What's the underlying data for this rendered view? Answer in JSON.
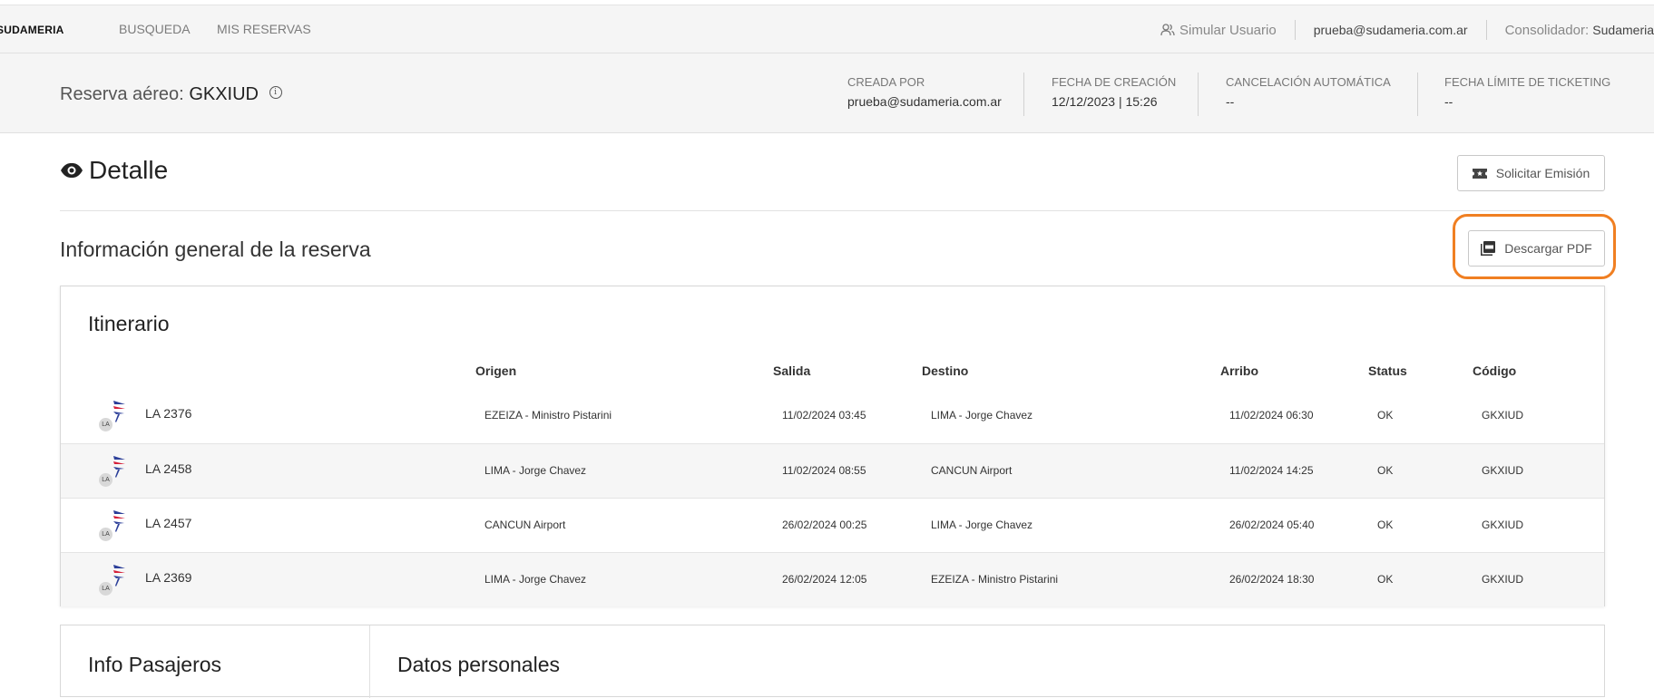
{
  "topbar": {
    "logo": "SUDAMERIA",
    "nav": [
      "BUSQUEDA",
      "MIS RESERVAS"
    ],
    "simular": "Simular Usuario",
    "email": "prueba@sudameria.com.ar",
    "consolidador_label": "Consolidador:",
    "consolidador_value": "Sudameria"
  },
  "reserva": {
    "prefix": "Reserva aéreo:",
    "code": "GKXIUD",
    "info_glyph": "i",
    "meta": [
      {
        "label": "CREADA POR",
        "value": "prueba@sudameria.com.ar"
      },
      {
        "label": "FECHA DE CREACIÓN",
        "value": "12/12/2023 | 15:26"
      },
      {
        "label": "CANCELACIÓN AUTOMÁTICA",
        "value": "--"
      },
      {
        "label": "FECHA LÍMITE DE TICKETING",
        "value": "--"
      }
    ]
  },
  "detalle": {
    "title": "Detalle",
    "solicitar_label": "Solicitar Emisión"
  },
  "info_general": {
    "title": "Información general de la reserva",
    "descargar_label": "Descargar PDF"
  },
  "itinerario": {
    "title": "Itinerario",
    "columns": [
      "Origen",
      "Salida",
      "Destino",
      "Arribo",
      "Status",
      "Código"
    ],
    "rows": [
      {
        "badge": "LA",
        "flight": "LA 2376",
        "origen": "EZEIZA - Ministro Pistarini",
        "salida": "11/02/2024 03:45",
        "destino": "LIMA - Jorge Chavez",
        "arribo": "11/02/2024 06:30",
        "status": "OK",
        "codigo": "GKXIUD"
      },
      {
        "badge": "LA",
        "flight": "LA 2458",
        "origen": "LIMA - Jorge Chavez",
        "salida": "11/02/2024 08:55",
        "destino": "CANCUN Airport",
        "arribo": "11/02/2024 14:25",
        "status": "OK",
        "codigo": "GKXIUD"
      },
      {
        "badge": "LA",
        "flight": "LA 2457",
        "origen": "CANCUN Airport",
        "salida": "26/02/2024 00:25",
        "destino": "LIMA - Jorge Chavez",
        "arribo": "26/02/2024 05:40",
        "status": "OK",
        "codigo": "GKXIUD"
      },
      {
        "badge": "LA",
        "flight": "LA 2369",
        "origen": "LIMA - Jorge Chavez",
        "salida": "26/02/2024 12:05",
        "destino": "EZEIZA - Ministro Pistarini",
        "arribo": "26/02/2024 18:30",
        "status": "OK",
        "codigo": "GKXIUD"
      }
    ]
  },
  "pasajeros": {
    "title": "Info Pasajeros",
    "datos_title": "Datos personales"
  },
  "colors": {
    "highlight": "#f07f22",
    "header_bg": "#f5f5f5",
    "airline_red": "#d6203a",
    "airline_blue": "#2c3f99"
  }
}
